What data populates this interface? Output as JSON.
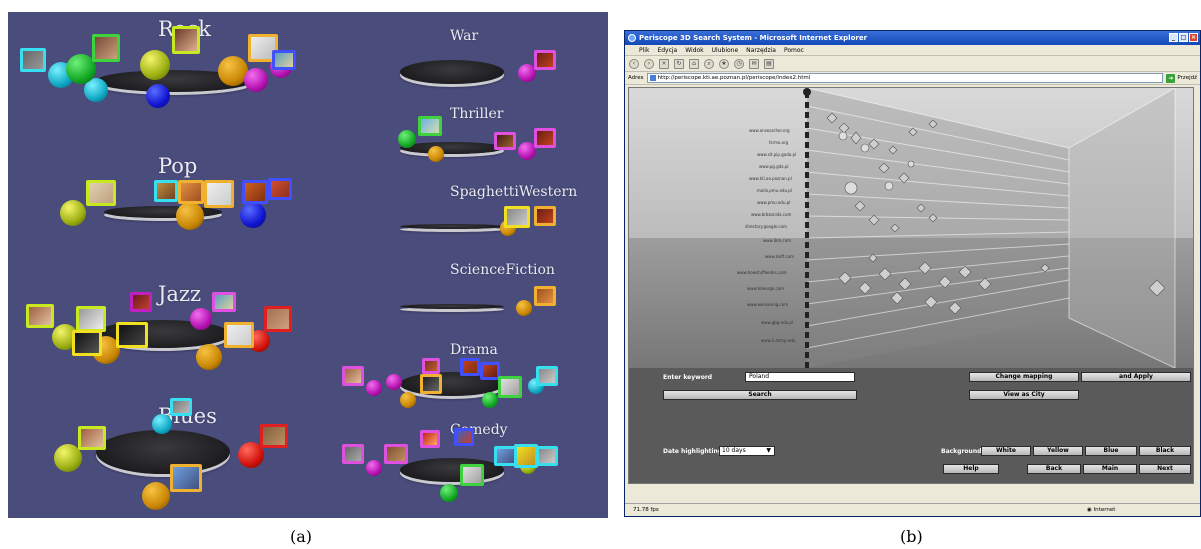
{
  "captions": {
    "a": "(a)",
    "b": "(b)"
  },
  "panel_a": {
    "genres": [
      "Rock",
      "Pop",
      "Jazz",
      "Blues",
      "War",
      "Thriller",
      "SpaghettiWestern",
      "ScienceFiction",
      "Drama",
      "Comedy"
    ]
  },
  "browser": {
    "title": "Periscope 3D Search System - Microsoft Internet Explorer",
    "window_buttons": [
      "_",
      "□"
    ],
    "menu": [
      "Plik",
      "Edycja",
      "Widok",
      "Ulubione",
      "Narzędzia",
      "Pomoc"
    ],
    "address_label": "Adres",
    "address_value": "http://periscope.kti.ae.poznan.pl/periscope/index2.html",
    "go_label": "Przejdź",
    "url_labels": [
      "www.onsearcher.org",
      "fsrmo.org",
      "www.sit.pip.gada.pl",
      "www.pg.gda.pl",
      "www.kti.ae.poznan.pl",
      "mailo.pmu.edu.pl",
      "www.pmu.edu.pl",
      "www.brbzonida.com",
      "directory.google.com",
      "www.ibm.com",
      "www.lsoft.com",
      "www.howstuffworks.com",
      "www.teleorgo.com",
      "www.weinaning.com",
      "www.gbg.edu.pl",
      "www.2.dsmp.edu"
    ],
    "controls": {
      "enter_keyword_label": "Enter keyword",
      "keyword_value": "Poland",
      "search_button": "Search",
      "change_mapping_button": "Change mapping",
      "and_apply_button": "and Apply",
      "view_as_city_button": "View as City",
      "date_highlighting_label": "Date highlighting",
      "date_highlighting_value": "10 days",
      "background_label": "Background",
      "background_options": [
        "White",
        "Yellow",
        "Blue",
        "Black"
      ],
      "help_button": "Help",
      "back_button": "Back",
      "main_button": "Main",
      "next_button": "Next"
    },
    "status": {
      "fps": "71.78 fps",
      "zone": "Internet"
    }
  }
}
